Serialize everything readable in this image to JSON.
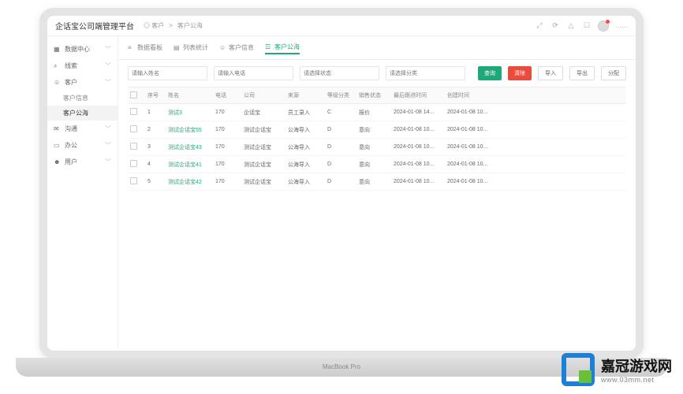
{
  "header": {
    "logo": "企话宝公司端管理平台",
    "breadcrumb_home": "◎ 客户",
    "breadcrumb_separator": ">",
    "breadcrumb_current": "客户公海",
    "username": "……"
  },
  "laptop_label": "MacBook Pro",
  "sidebar": {
    "items": [
      {
        "icon": "grid",
        "label": "数据中心"
      },
      {
        "icon": "search",
        "label": "线索"
      },
      {
        "icon": "user",
        "label": "客户"
      },
      {
        "icon": "chat",
        "label": "沟通"
      },
      {
        "icon": "briefcase",
        "label": "办公"
      },
      {
        "icon": "people",
        "label": "用户"
      }
    ],
    "subitems": [
      {
        "label": "客户信息"
      },
      {
        "label": "客户公海"
      }
    ]
  },
  "tabs": [
    {
      "label": "数据看板"
    },
    {
      "label": "列表统计"
    },
    {
      "label": "客户信息"
    },
    {
      "label": "客户公海"
    }
  ],
  "filters": {
    "name_ph": "请输入姓名",
    "phone_ph": "请输入电话",
    "status_ph": "请选择状态",
    "cat_ph": "请选择分类",
    "search_btn": "查询",
    "reset_btn": "清除",
    "import_btn": "导入",
    "export_btn": "导出",
    "assign_btn": "分配"
  },
  "columns": [
    "",
    "序号",
    "姓名",
    "电话",
    "公司",
    "来源",
    "等级分类",
    "销售状态",
    "最后跟进时间",
    "创建时间"
  ],
  "rows": [
    {
      "idx": "1",
      "name": "测试3",
      "phone": "170",
      "company": "企话宝",
      "source": "员工录入",
      "level": "C",
      "status": "报价",
      "follow": "2024-01-08 14...",
      "create": "2024-01-08 10..."
    },
    {
      "idx": "2",
      "name": "测试企话宝55",
      "phone": "170",
      "company": "测试企话宝",
      "source": "公海导入",
      "level": "D",
      "status": "意向",
      "follow": "2024-01-08 10...",
      "create": "2024-01-08 10..."
    },
    {
      "idx": "3",
      "name": "测试企话宝43",
      "phone": "170",
      "company": "测试企话宝",
      "source": "公海导入",
      "level": "D",
      "status": "意向",
      "follow": "2024-01-08 10...",
      "create": "2024-01-08 10..."
    },
    {
      "idx": "4",
      "name": "测试企话宝41",
      "phone": "170",
      "company": "测试企话宝",
      "source": "公海导入",
      "level": "D",
      "status": "意向",
      "follow": "2024-01-08 10...",
      "create": "2024-01-08 10..."
    },
    {
      "idx": "5",
      "name": "测试企话宝42",
      "phone": "170",
      "company": "测试企话宝",
      "source": "公海导入",
      "level": "D",
      "status": "意向",
      "follow": "2024-01-08 10...",
      "create": "2024-01-08 10..."
    }
  ],
  "watermark": {
    "title": "嘉冠游戏网",
    "url": "www.03mm.net"
  }
}
